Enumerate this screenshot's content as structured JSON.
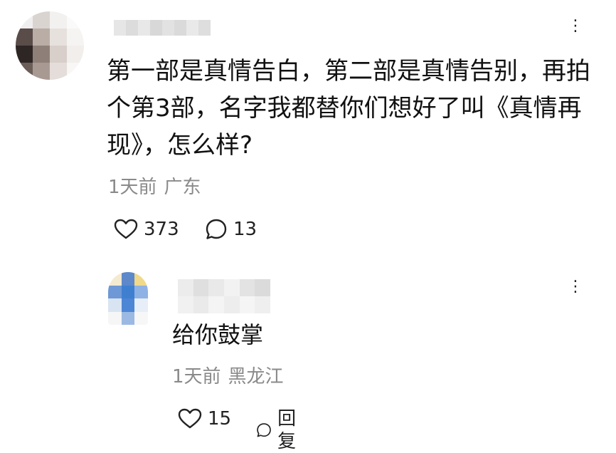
{
  "comment": {
    "text": "第一部是真情告白，第二部是真情告别，再拍个第3部，名字我都替你们想好了叫《真情再现》，怎么样?",
    "time": "1天前",
    "location": "广东",
    "likes": "373",
    "replies": "13",
    "more_icon": "more-icon",
    "like_icon": "heart-icon",
    "reply_icon": "speech-bubble-icon"
  },
  "reply": {
    "text": "给你鼓掌",
    "time": "1天前",
    "location": "黑龙江",
    "likes": "15",
    "reply_label": "回复",
    "more_icon": "more-icon",
    "like_icon": "heart-icon",
    "reply_icon": "speech-bubble-icon"
  },
  "colors": {
    "text": "#111111",
    "meta": "#8a8a8a",
    "background": "#ffffff",
    "reply_avatar_accent": "#3f7fd0"
  }
}
